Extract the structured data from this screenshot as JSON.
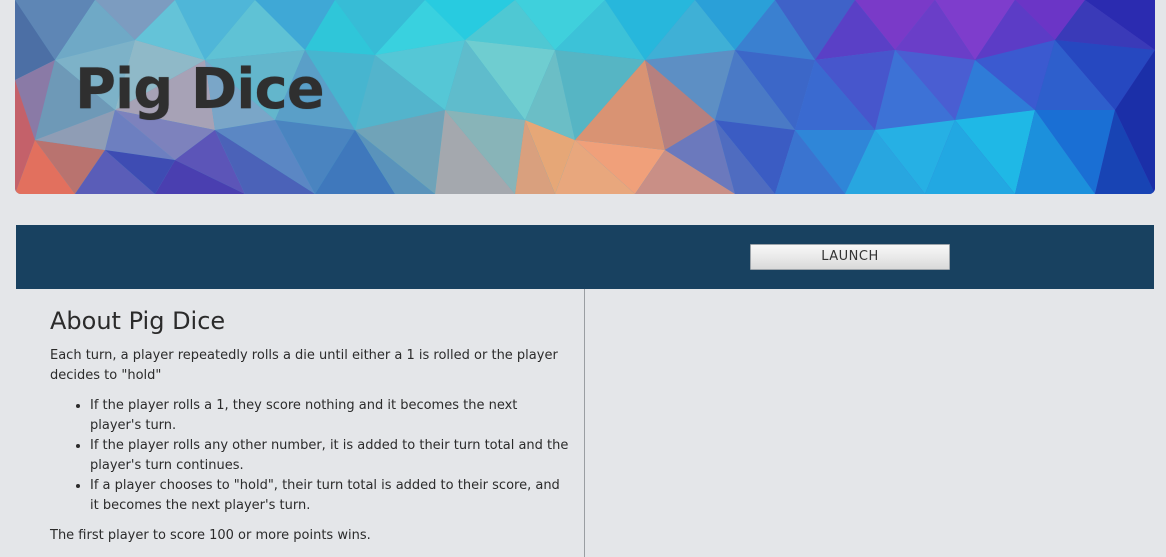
{
  "banner": {
    "title": "Pig Dice"
  },
  "launch_bar": {
    "button_label": "LAUNCH"
  },
  "about": {
    "heading": "About Pig Dice",
    "intro": "Each turn, a player repeatedly rolls a die until either a 1 is rolled or the player decides to \"hold\"",
    "rules": [
      "If the player rolls a 1, they score nothing and it becomes the next player's turn.",
      "If the player rolls any other number, it is added to their turn total and the player's turn continues.",
      "If a player chooses to \"hold\", their turn total is added to their score, and it becomes the next player's turn."
    ],
    "win_condition": "The first player to score 100 or more points wins."
  },
  "colors": {
    "page_background": "#e4e6e9",
    "launch_bar_background": "#184160",
    "divider": "#9a9ea2",
    "text": "#2b2b2b"
  }
}
